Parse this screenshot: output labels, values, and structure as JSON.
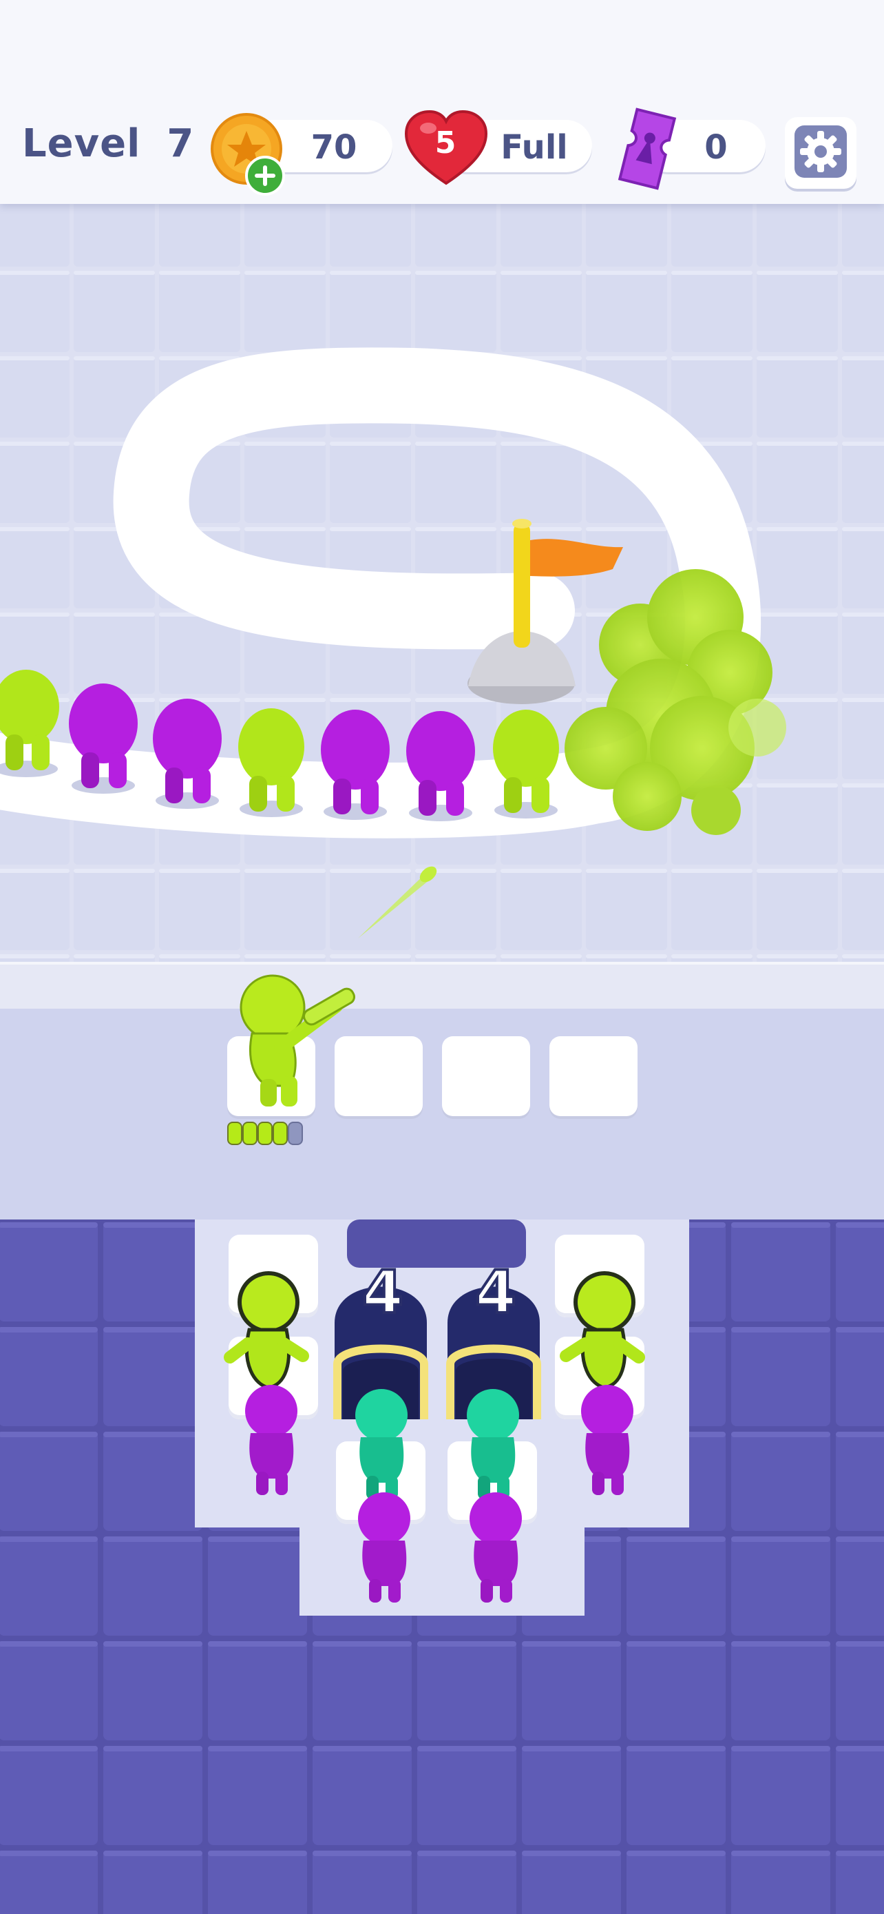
{
  "hud": {
    "level_label": "Level",
    "level_number": "7",
    "coins": "70",
    "lives_count": "5",
    "lives_status": "Full",
    "tickets": "0"
  },
  "tunnels": [
    {
      "count": "4"
    },
    {
      "count": "4"
    }
  ],
  "shooter": {
    "ammo_total": 5,
    "ammo_filled": 4
  },
  "colors": {
    "lime": "#b5ea18",
    "magenta": "#b51fe0",
    "teal": "#1fd4a0",
    "board": "#5552a8",
    "accent": "#4b5486"
  },
  "icons": {
    "coin": "coin-icon",
    "add": "add-coins-icon",
    "heart": "heart-icon",
    "ticket": "ticket-icon",
    "settings": "gear-icon",
    "flag": "goal-flag-icon"
  }
}
